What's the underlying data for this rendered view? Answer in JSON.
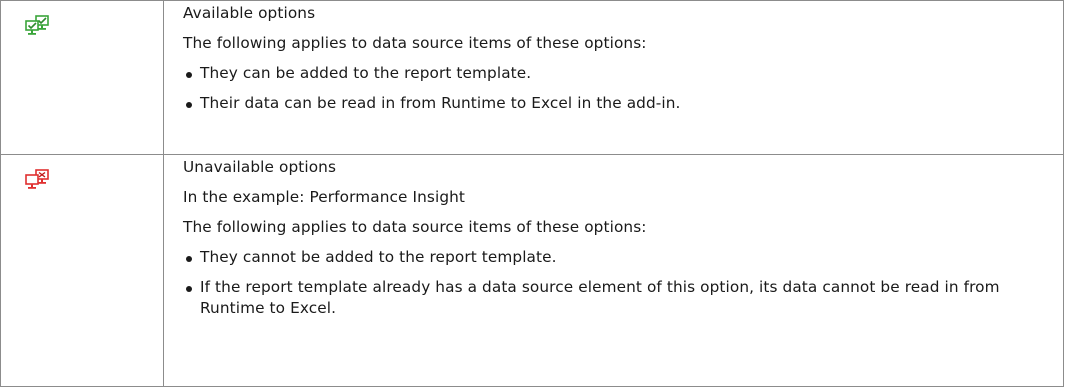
{
  "table": {
    "rows": [
      {
        "icon": "options-available-green-icon",
        "icon_color": "#3aa53a",
        "title": "Available options",
        "intro": "The following applies to data source items of these options:",
        "bullets": [
          "They can be added to the report template.",
          "Their data can be read in from Runtime to Excel in the add-in."
        ]
      },
      {
        "icon": "options-unavailable-red-icon",
        "icon_color": "#e03030",
        "title": "Unavailable options",
        "example": "In the example: Performance Insight",
        "intro": "The following applies to data source items of these options:",
        "bullets": [
          "They cannot be added to the report template.",
          "If the report template already has a data source element of this option, its data cannot be read in from Runtime to Excel."
        ]
      }
    ]
  }
}
